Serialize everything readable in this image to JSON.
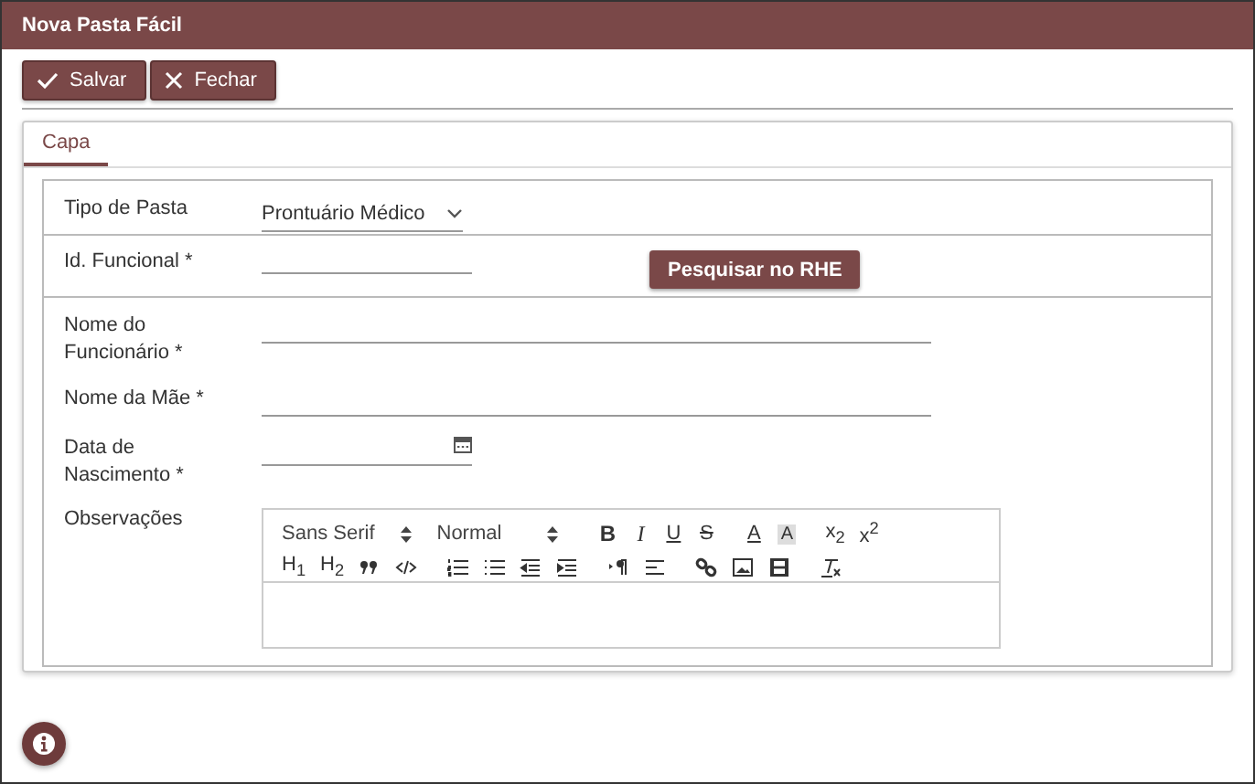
{
  "window": {
    "title": "Nova Pasta Fácil"
  },
  "actions": [
    {
      "kind": "check",
      "label": "Salvar"
    },
    {
      "kind": "close",
      "label": "Fechar"
    }
  ],
  "tabs": [
    {
      "label": "Capa",
      "selected": true
    }
  ],
  "form": {
    "folder_type": {
      "label": "Tipo de Pasta",
      "value": "Prontuário Médico"
    },
    "functional_id": {
      "label": "Id. Funcional *",
      "button": "Pesquisar no RHE"
    },
    "fields": [
      {
        "kind": "text",
        "label": "Nome do Funcionário *"
      },
      {
        "kind": "text",
        "label": "Nome da Mãe *"
      },
      {
        "kind": "date",
        "label": "Data de Nascimento *"
      }
    ],
    "notes": {
      "label": "Observações",
      "toolbar": [
        [
          {
            "kind": "picker",
            "label": "Sans Serif"
          },
          {
            "kind": "picker",
            "label": "Normal"
          },
          {
            "kind": "bold",
            "label": "B"
          },
          {
            "kind": "italic",
            "label": "I"
          },
          {
            "kind": "underline",
            "label": "U"
          },
          {
            "kind": "strike",
            "label": "S"
          },
          {
            "kind": "color",
            "label": "A"
          },
          {
            "kind": "background",
            "label": "A"
          },
          {
            "kind": "script",
            "label": "x$_{2}$"
          },
          {
            "kind": "script",
            "label": "x$^{2}$"
          }
        ],
        [
          {
            "kind": "script",
            "label": "H$_{1}$"
          },
          {
            "kind": "script",
            "label": "H$_{2}$"
          },
          {
            "kind": "quote"
          },
          {
            "kind": "code"
          },
          {
            "kind": "ol"
          },
          {
            "kind": "ul"
          },
          {
            "kind": "outdent"
          },
          {
            "kind": "indent"
          },
          {
            "kind": "rtl"
          },
          {
            "kind": "align"
          },
          {
            "kind": "link"
          },
          {
            "kind": "image"
          },
          {
            "kind": "video"
          },
          {
            "kind": "clean"
          }
        ]
      ]
    }
  }
}
